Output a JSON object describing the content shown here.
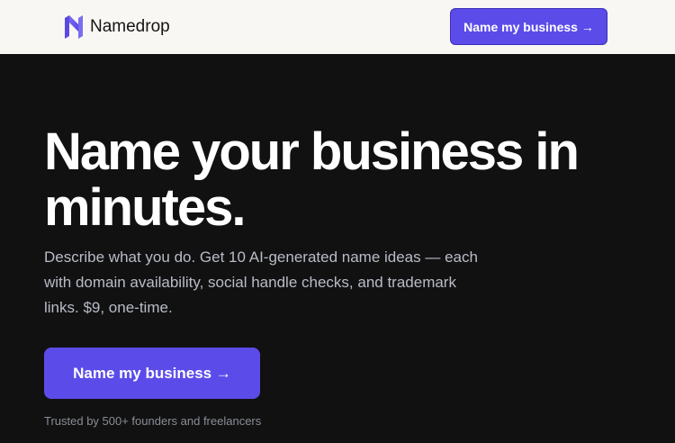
{
  "nav": {
    "brand": "Namedrop",
    "logo_icon": "n-logo-icon",
    "cta_label": "Name my business →"
  },
  "hero": {
    "title": "Name your business in minutes.",
    "subtitle": "Describe what you do. Get 10 AI-generated name ideas — each with domain availability, social handle checks, and trademark links. $9, one-time.",
    "cta_label": "Name my business →",
    "trust_text": "Trusted by 500+ founders and freelancers"
  },
  "colors": {
    "brand": "#5b4ce9",
    "background": "#111112",
    "header": "#f9f7f3"
  }
}
